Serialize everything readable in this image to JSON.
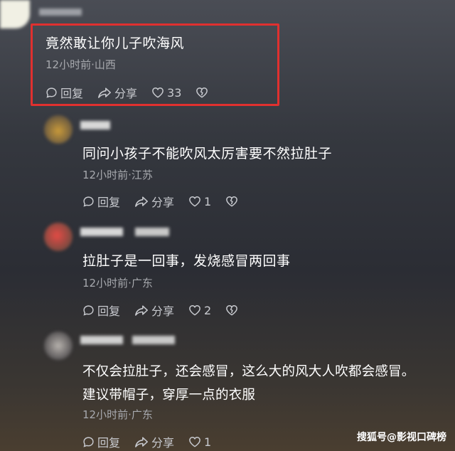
{
  "comments": [
    {
      "text": "竟然敢让你儿子吹海风",
      "meta": "12小时前·山西",
      "reply": "回复",
      "share": "分享",
      "likes": "33"
    },
    {
      "text": "同问小孩子不能吹风太厉害要不然拉肚子",
      "meta": "12小时前·江苏",
      "reply": "回复",
      "share": "分享",
      "likes": "1"
    },
    {
      "text": "拉肚子是一回事，发烧感冒两回事",
      "meta": "12小时前·广东",
      "reply": "回复",
      "share": "分享",
      "likes": "2"
    },
    {
      "text_line1": "不仅会拉肚子，还会感冒，这么大的风大人吹都会感冒。",
      "text_line2": "建议带帽子，穿厚一点的衣服",
      "meta": "12小时前·广东",
      "reply": "回复",
      "share": "分享",
      "likes": "1"
    }
  ],
  "watermark": "搜狐号@影视口碑榜",
  "colors": {
    "highlight_border": "#e0302f",
    "meta_text": "#a7a9ae"
  }
}
